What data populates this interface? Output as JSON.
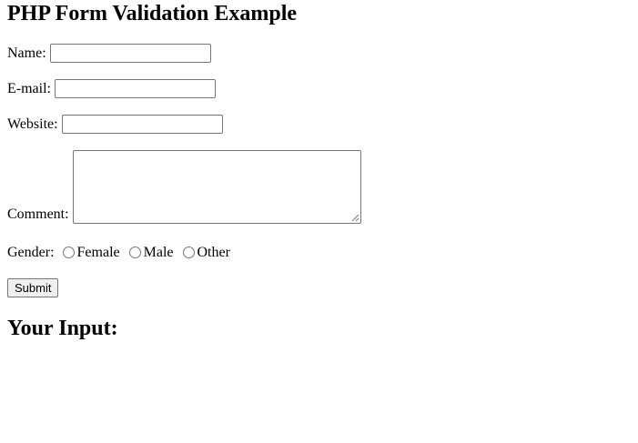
{
  "page": {
    "title": "PHP Form Validation Example",
    "result_title": "Your Input:"
  },
  "form": {
    "name": {
      "label": "Name:",
      "value": ""
    },
    "email": {
      "label": "E-mail:",
      "value": ""
    },
    "website": {
      "label": "Website:",
      "value": ""
    },
    "comment": {
      "label": "Comment:",
      "value": ""
    },
    "gender": {
      "label": "Gender:",
      "options": [
        {
          "label": "Female",
          "checked": false
        },
        {
          "label": "Male",
          "checked": false
        },
        {
          "label": "Other",
          "checked": false
        }
      ]
    },
    "submit_label": "Submit"
  },
  "icons": {
    "radio": "radio-unchecked-icon",
    "resize": "resize-grip-icon"
  },
  "colors": {
    "text": "#000000",
    "border": "#767676",
    "button_bg": "#efefef",
    "background": "#ffffff"
  }
}
